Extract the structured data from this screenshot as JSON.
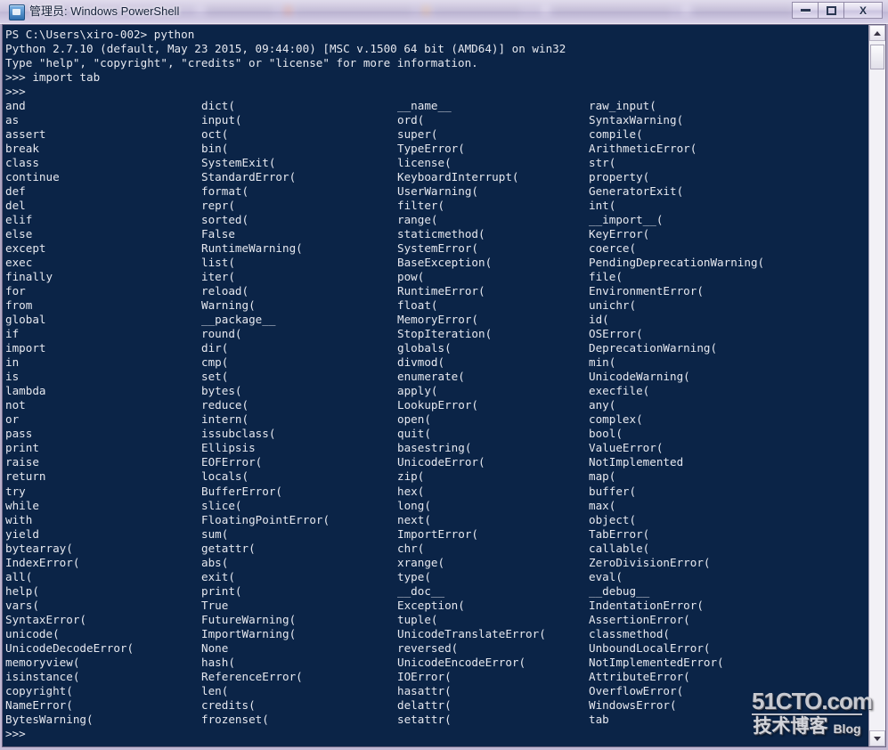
{
  "window": {
    "title": "管理员: Windows PowerShell",
    "icon": "powershell-icon",
    "controls": {
      "minimize_label": "",
      "maximize_label": "",
      "close_label": "X"
    }
  },
  "console": {
    "header_lines": [
      "PS C:\\Users\\xiro-002> python",
      "Python 2.7.10 (default, May 23 2015, 09:44:00) [MSC v.1500 64 bit (AMD64)] on win32",
      "Type \"help\", \"copyright\", \"credits\" or \"license\" for more information.",
      ">>> import tab",
      ">>>"
    ],
    "prompt_last": ">>>",
    "completion_columns": [
      [
        "and",
        "as",
        "assert",
        "break",
        "class",
        "continue",
        "def",
        "del",
        "elif",
        "else",
        "except",
        "exec",
        "finally",
        "for",
        "from",
        "global",
        "if",
        "import",
        "in",
        "is",
        "lambda",
        "not",
        "or",
        "pass",
        "print",
        "raise",
        "return",
        "try",
        "while",
        "with",
        "yield",
        "bytearray(",
        "IndexError(",
        "all(",
        "help(",
        "vars(",
        "SyntaxError(",
        "unicode(",
        "UnicodeDecodeError(",
        "memoryview(",
        "isinstance(",
        "copyright(",
        "NameError(",
        "BytesWarning("
      ],
      [
        "dict(",
        "input(",
        "oct(",
        "bin(",
        "SystemExit(",
        "StandardError(",
        "format(",
        "repr(",
        "sorted(",
        "False",
        "RuntimeWarning(",
        "list(",
        "iter(",
        "reload(",
        "Warning(",
        "__package__",
        "round(",
        "dir(",
        "cmp(",
        "set(",
        "bytes(",
        "reduce(",
        "intern(",
        "issubclass(",
        "Ellipsis",
        "EOFError(",
        "locals(",
        "BufferError(",
        "slice(",
        "FloatingPointError(",
        "sum(",
        "getattr(",
        "abs(",
        "exit(",
        "print(",
        "True",
        "FutureWarning(",
        "ImportWarning(",
        "None",
        "hash(",
        "ReferenceError(",
        "len(",
        "credits(",
        "frozenset("
      ],
      [
        "__name__",
        "ord(",
        "super(",
        "TypeError(",
        "license(",
        "KeyboardInterrupt(",
        "UserWarning(",
        "filter(",
        "range(",
        "staticmethod(",
        "SystemError(",
        "BaseException(",
        "pow(",
        "RuntimeError(",
        "float(",
        "MemoryError(",
        "StopIteration(",
        "globals(",
        "divmod(",
        "enumerate(",
        "apply(",
        "LookupError(",
        "open(",
        "quit(",
        "basestring(",
        "UnicodeError(",
        "zip(",
        "hex(",
        "long(",
        "next(",
        "ImportError(",
        "chr(",
        "xrange(",
        "type(",
        "__doc__",
        "Exception(",
        "tuple(",
        "UnicodeTranslateError(",
        "reversed(",
        "UnicodeEncodeError(",
        "IOError(",
        "hasattr(",
        "delattr(",
        "setattr("
      ],
      [
        "raw_input(",
        "SyntaxWarning(",
        "compile(",
        "ArithmeticError(",
        "str(",
        "property(",
        "GeneratorExit(",
        "int(",
        "__import__(",
        "KeyError(",
        "coerce(",
        "PendingDeprecationWarning(",
        "file(",
        "EnvironmentError(",
        "unichr(",
        "id(",
        "OSError(",
        "DeprecationWarning(",
        "min(",
        "UnicodeWarning(",
        "execfile(",
        "any(",
        "complex(",
        "bool(",
        "ValueError(",
        "NotImplemented",
        "map(",
        "buffer(",
        "max(",
        "object(",
        "TabError(",
        "callable(",
        "ZeroDivisionError(",
        "eval(",
        "__debug__",
        "IndentationError(",
        "AssertionError(",
        "classmethod(",
        "UnboundLocalError(",
        "NotImplementedError(",
        "AttributeError(",
        "OverflowError(",
        "WindowsError(",
        "tab"
      ]
    ]
  },
  "scrollbar": {
    "up_icon": "arrow-up-icon",
    "down_icon": "arrow-down-icon"
  },
  "watermark": {
    "top": "51CTO.com",
    "bottom_cn": "技术博客",
    "bottom_en": "Blog"
  },
  "colors": {
    "console_bg": "#0b2447",
    "console_fg": "#e6e8ef",
    "frame": "#b9aec9",
    "titlebar": "#d5cfe7"
  }
}
